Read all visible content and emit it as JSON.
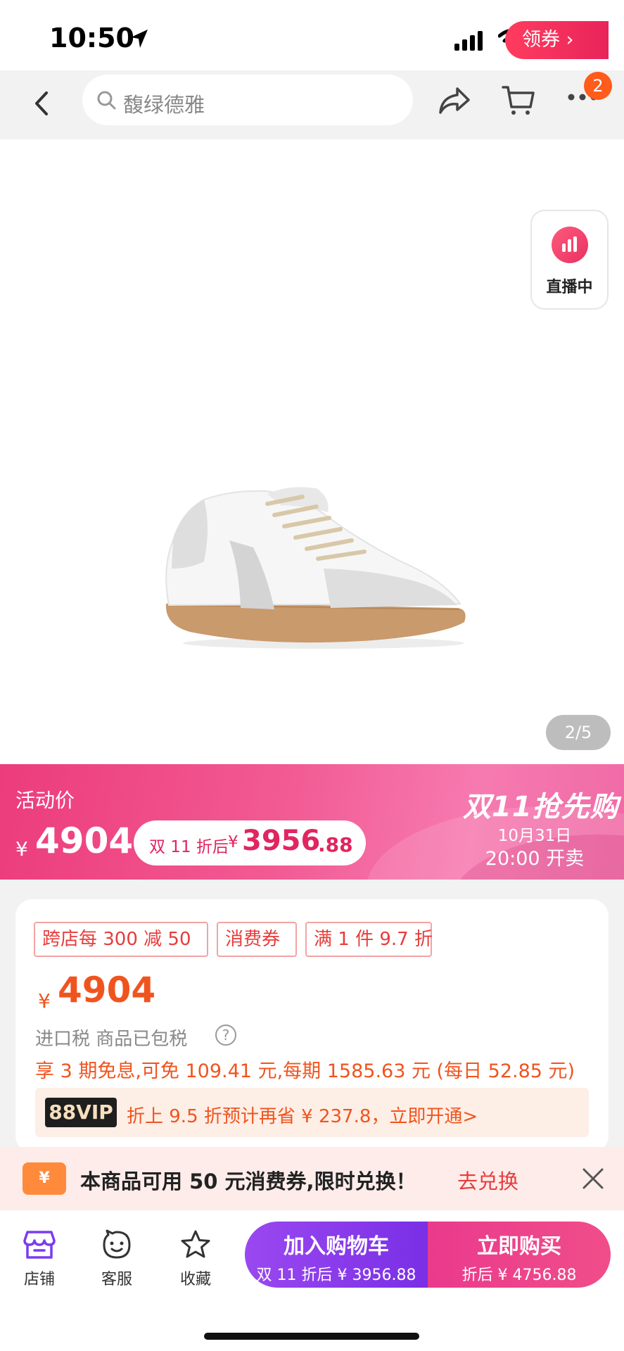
{
  "status_bar": {
    "time": "10:50"
  },
  "nav": {
    "search_placeholder": "馥绿德雅",
    "more_badge": "2"
  },
  "gallery": {
    "live_label": "直播中",
    "page_indicator": "2/5"
  },
  "promo": {
    "label": "活动价",
    "currency": "¥",
    "price": "4904",
    "pill_label": "双 11 折后",
    "pill_currency": "¥",
    "pill_price": "3956",
    "pill_decimal": ".88",
    "event_title": "双11抢先购",
    "event_date": "10月31日",
    "event_time": "20:00 开卖"
  },
  "card": {
    "tags": [
      "跨店每 300 减 50",
      "消费券",
      "满 1 件 9.7 折"
    ],
    "coupon_button": "领券 ›",
    "currency": "¥",
    "price": "4904",
    "tax_text": "进口税 商品已包税",
    "tax_help": "?",
    "installment_text": "享 3 期免息,可免 109.41 元,每期 1585.63 元 (每日 52.85 元)",
    "vip_badge": "88VIP",
    "vip_text": "折上 9.5 折预计再省 ¥ 237.8，立即开通>"
  },
  "notice": {
    "icon_text": "¥",
    "text": "本商品可用 50 元消费券,限时兑换！",
    "link": "去兑换"
  },
  "bottom": {
    "tabs": [
      {
        "label": "店铺",
        "icon": "store-icon"
      },
      {
        "label": "客服",
        "icon": "customer-service-icon"
      },
      {
        "label": "收藏",
        "icon": "star-icon"
      }
    ],
    "cart_button": {
      "main": "加入购物车",
      "sub": "双 11 折后 ¥ 3956.88"
    },
    "buy_button": {
      "main": "立即购买",
      "sub": "折后 ¥ 4756.88"
    }
  },
  "colors": {
    "accent_orange": "#f0541e",
    "promo_pink": "#ec3c7b",
    "cart_purple": "#8a3cec",
    "buy_pink": "#ea3a8c"
  }
}
